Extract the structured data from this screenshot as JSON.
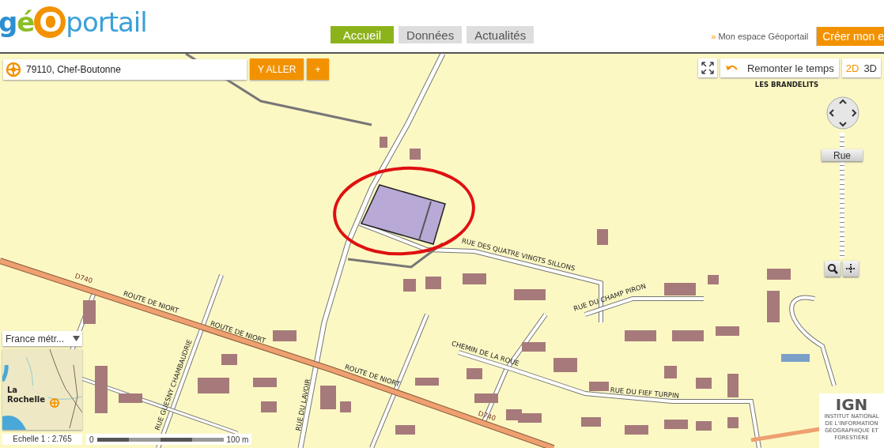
{
  "header": {
    "logo": "géOportail",
    "nav": [
      {
        "label": "Accueil",
        "selected": true
      },
      {
        "label": "Données",
        "selected": false
      },
      {
        "label": "Actualités",
        "selected": false
      }
    ],
    "account_link": "Mon espace Géoportail",
    "account_marker": "»",
    "create_button": "Créer mon e"
  },
  "search": {
    "value": "79110, Chef-Boutonne",
    "go_button": "Y ALLER",
    "add_button": "+"
  },
  "map_tools": {
    "history_button": "Remonter le temps",
    "view_modes": [
      {
        "label": "2D",
        "selected": true
      },
      {
        "label": "3D",
        "selected": false
      }
    ]
  },
  "zoom": {
    "label": "Rue",
    "level": 0.82
  },
  "map_labels": [
    "LES BRANDELITS",
    "ROUTE DE NIORT",
    "ROUTE DE NIORT",
    "ROUTE DE NIORT",
    "D740",
    "D740",
    "RUE DES QUATRE VINGTS SILLONS",
    "RUE DU CHAMP PIRON",
    "CHEMIN DE LA ROUE",
    "RUE DU FIEF TURPIN",
    "RUE DU LAVOIR",
    "RUE GUESNY CHAMBAUDRIE"
  ],
  "overview": {
    "territory": "France métr...",
    "place": "La Rochelle"
  },
  "scale": {
    "ratio": "Echelle 1 :  2.765",
    "start": "0",
    "end": "100 m"
  },
  "credit": {
    "logo": "IGN",
    "name": "INSTITUT NATIONAL DE L'INFORMATION GÉOGRAPHIQUE ET FORESTIÈRE"
  }
}
